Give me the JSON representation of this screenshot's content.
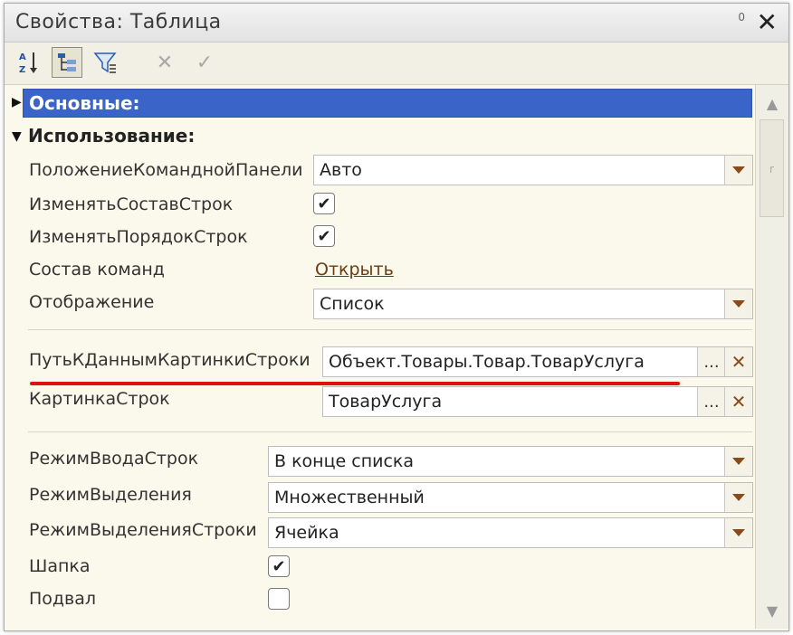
{
  "window": {
    "title": "Свойства: Таблица",
    "pin_label": "0",
    "close_label": "✕"
  },
  "toolbar": {
    "sort_icon": "az-sort-icon",
    "tree_icon": "tree-view-icon",
    "filter_icon": "filter-icon",
    "cancel_label": "✕",
    "apply_label": "✓"
  },
  "groups": {
    "main": "Основные:",
    "usage": "Использование:"
  },
  "properties": {
    "command_panel_position": {
      "label": "ПоложениеКоманднойПанели",
      "value": "Авто"
    },
    "change_rows_set": {
      "label": "ИзменятьСоставСтрок",
      "checked": "✔"
    },
    "change_rows_order": {
      "label": "ИзменятьПорядокСтрок",
      "checked": "✔"
    },
    "commands": {
      "label": "Состав команд",
      "link": "Открыть"
    },
    "display": {
      "label": "Отображение",
      "value": "Список"
    },
    "row_picture_data_path": {
      "label": "ПутьКДаннымКартинкиСтроки",
      "value": "Объект.Товары.Товар.ТоварУслуга"
    },
    "row_picture": {
      "label": "КартинкаСтрок",
      "value": "ТоварУслуга"
    },
    "row_input_mode": {
      "label": "РежимВводаСтрок",
      "value": "В конце списка"
    },
    "selection_mode": {
      "label": "РежимВыделения",
      "value": "Множественный"
    },
    "row_selection_mode": {
      "label": "РежимВыделенияСтроки",
      "value": "Ячейка"
    },
    "header": {
      "label": "Шапка",
      "checked": "✔"
    },
    "footer": {
      "label": "Подвал",
      "checked": ""
    }
  },
  "buttons": {
    "select_label": "...",
    "clear_label": "✕"
  },
  "scrollbar": {
    "up": "▲",
    "down": "▼",
    "grip": "r"
  },
  "colors": {
    "header_bar": "#3b64c8",
    "accent_arrow": "#8a4a1a",
    "highlight_underline": "#e01010"
  }
}
